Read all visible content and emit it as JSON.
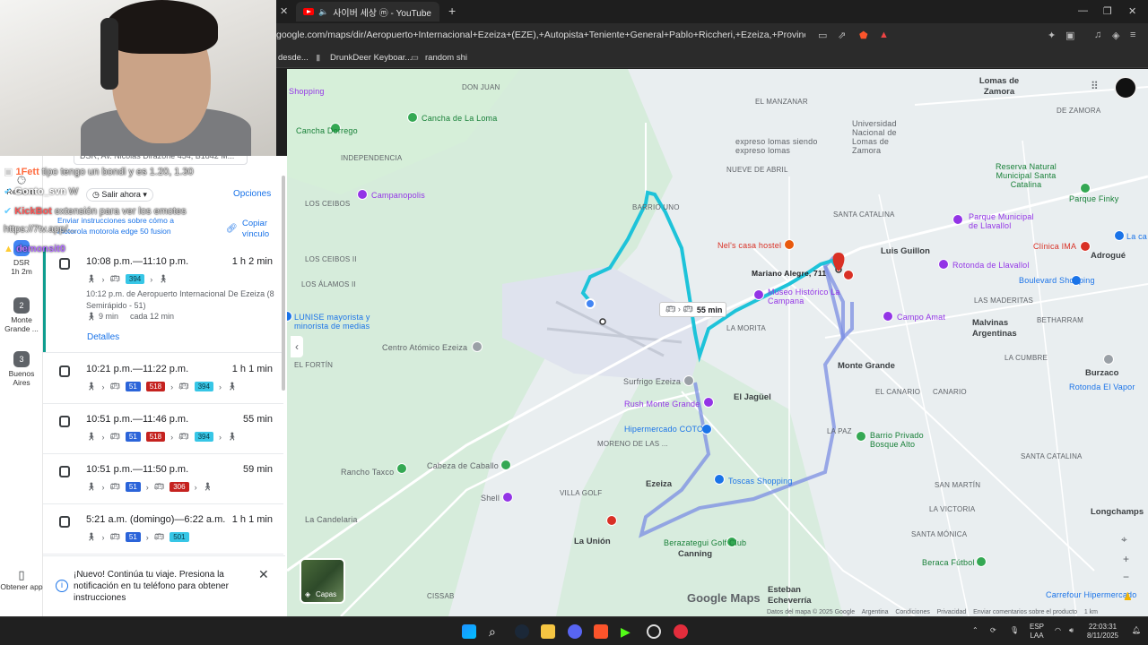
{
  "browser": {
    "tab_title": "사이버 세상 ⓜ - YouTube",
    "url": "google.com/maps/dir/Aeropuerto+Internacional+Ezeiza+(EZE),+Autopista+Teniente+General+Pablo+Riccheri,+Ezeiza,+Provincia+de+Buenos...",
    "bookmarks": [
      "desde...",
      "DrunkDeer Keyboar...",
      "random shi"
    ]
  },
  "left_nav": [
    {
      "label": "Reciente"
    },
    {
      "label": "DSR",
      "sub": "1h 2m"
    },
    {
      "label": "Monte Grande ...",
      "num": "2"
    },
    {
      "label": "Buenos Aires",
      "num": "3"
    },
    {
      "label": "Obtener app"
    }
  ],
  "panel": {
    "origin_field": "DSR, Av. Nicolás Dirazone 454, B1842 M...",
    "depart_label": "Salir ahora",
    "options_label": "Opciones",
    "send_text": "Enviar instrucciones sobre cómo a motorola motorola edge 50 fusion",
    "copy_link": "Copiar vínculo",
    "details_label": "Detalles",
    "selected_route_extra": "10:12 p.m. de Aeropuerto Internacional De Ezeiza (8 Semirápido - 51)",
    "selected_walk": "9 min",
    "selected_freq": "cada 12 min",
    "routes": [
      {
        "time": "10:08 p.m.—11:10 p.m.",
        "duration": "1 h 2 min",
        "badges": [
          {
            "text": "394",
            "color": "cyan"
          }
        ]
      },
      {
        "time": "10:21 p.m.—11:22 p.m.",
        "duration": "1 h 1 min",
        "badges": [
          {
            "text": "51",
            "color": "blue"
          },
          {
            "text": "518",
            "color": "red"
          },
          {
            "text": "394",
            "color": "cyan"
          }
        ]
      },
      {
        "time": "10:51 p.m.—11:46 p.m.",
        "duration": "55 min",
        "badges": [
          {
            "text": "51",
            "color": "blue"
          },
          {
            "text": "518",
            "color": "red"
          },
          {
            "text": "394",
            "color": "cyan"
          }
        ]
      },
      {
        "time": "10:51 p.m.—11:50 p.m.",
        "duration": "59 min",
        "badges": [
          {
            "text": "51",
            "color": "blue"
          },
          {
            "text": "306",
            "color": "red"
          }
        ]
      },
      {
        "time": "5:21 a.m. (domingo)—6:22 a.m.",
        "duration": "1 h 1 min",
        "badges": [
          {
            "text": "51",
            "color": "blue"
          },
          {
            "text": "501",
            "color": "cyan"
          }
        ]
      }
    ],
    "notification": "¡Nuevo! Continúa tu viaje. Presiona la notificación en tu teléfono para obtener instrucciones"
  },
  "chat": [
    {
      "user": "1Fett",
      "text": "tipo tengo un bondi y es 1.20, 1.30",
      "color": "#ff6a3d"
    },
    {
      "user": "Gonto_svn",
      "text": "W",
      "color": "#ffffff"
    },
    {
      "user": "KickBot",
      "text": "extensión para ver los emotes",
      "color": "#ff5a5a"
    },
    {
      "user": "",
      "text": "https://7tv.app/...",
      "color": "#ffffff"
    },
    {
      "user": "demonsit0",
      "text": "",
      "color": "#b06cff"
    }
  ],
  "map": {
    "duration_box": "55 min",
    "destination": "Mariano Alegre, 711",
    "layers_label": "Capas",
    "brand": "Google Maps",
    "copyright": [
      "Datos del mapa © 2025 Google",
      "Argentina",
      "Condiciones",
      "Privacidad",
      "Enviar comentarios sobre el producto",
      "1 km"
    ],
    "labels": [
      {
        "t": "DON JUAN"
      },
      {
        "t": "INDEPENDENCIA"
      },
      {
        "t": "LOS CEIBOS"
      },
      {
        "t": "BARRIO UNO"
      },
      {
        "t": "NUEVE DE ABRIL"
      },
      {
        "t": "EL MANZANAR"
      },
      {
        "t": "LOS ÁLAMOS II"
      },
      {
        "t": "LOS CEIBOS II"
      },
      {
        "t": "EL FORTÍN"
      },
      {
        "t": "LA MORITA"
      },
      {
        "t": "Monte Grande"
      },
      {
        "t": "El Jagüel"
      },
      {
        "t": "Luis Guillon"
      },
      {
        "t": "SANTA CATALINA"
      },
      {
        "t": "Malvinas Argentinas"
      },
      {
        "t": "Ezeiza"
      },
      {
        "t": "MORENO DE LAS ...",
        "id": "moreno"
      },
      {
        "t": "VILLA GOLF"
      },
      {
        "t": "La Unión"
      },
      {
        "t": "Canning"
      },
      {
        "t": "Esteban Echeverría"
      },
      {
        "t": "EL CANARIO"
      },
      {
        "t": "LA PAZ"
      },
      {
        "t": "SANTA CATALINA",
        "id": "sc2"
      },
      {
        "t": "SAN MARTÍN"
      },
      {
        "t": "LA VICTORIA"
      },
      {
        "t": "SANTA MÓNICA"
      },
      {
        "t": "LAS MADERITAS"
      },
      {
        "t": "BETHARRAM"
      },
      {
        "t": "Burzaco"
      },
      {
        "t": "Adrogué"
      },
      {
        "t": "Longchamps"
      },
      {
        "t": "Lomas de Zamora"
      },
      {
        "t": "DE ZAMORA"
      },
      {
        "t": "CISSAB"
      },
      {
        "t": "CANARIO"
      },
      {
        "t": "LA CUMBRE"
      }
    ],
    "pois": [
      {
        "t": "Cancha de La Loma",
        "kind": "green"
      },
      {
        "t": "Campanopolis",
        "kind": "purple"
      },
      {
        "t": "Nel's casa hostel",
        "kind": "pink"
      },
      {
        "t": "Museo Histórico La Campana",
        "kind": "purple"
      },
      {
        "t": "Campo Amat",
        "kind": "purple"
      },
      {
        "t": "Centro Atómico Ezeiza",
        "kind": "gray"
      },
      {
        "t": "Surfrigo Ezeiza",
        "kind": "gray"
      },
      {
        "t": "Rush Monte Grande",
        "kind": "purple"
      },
      {
        "t": "Hipermercado COTO",
        "kind": "blue"
      },
      {
        "t": "Toscas Shopping",
        "kind": "blue"
      },
      {
        "t": "Rancho Taxco",
        "kind": "gray"
      },
      {
        "t": "Cabeza de Caballo",
        "kind": "gray"
      },
      {
        "t": "Shell",
        "kind": "gray"
      },
      {
        "t": "Barrio Privado Bosque Alto",
        "kind": "green"
      },
      {
        "t": "Rotonda de Llavallol",
        "kind": "purple"
      },
      {
        "t": "Parque Municipal de Llavallol",
        "kind": "purple"
      },
      {
        "t": "Clínica IMA",
        "kind": "pink"
      },
      {
        "t": "Boulevard Shopping",
        "kind": "blue"
      },
      {
        "t": "Rotonda El Vapor",
        "kind": "blue"
      },
      {
        "t": "Berazategui Golf Club",
        "kind": "green"
      },
      {
        "t": "Beraca Fútbol",
        "kind": "green"
      },
      {
        "t": "Carrefour Hipermercado",
        "kind": "blue"
      },
      {
        "t": "Universidad Nacional de Lomas de Zamora",
        "kind": "gray"
      },
      {
        "t": "Reserva Natural Municipal Santa Catalina",
        "kind": "green"
      },
      {
        "t": "Parque Finky",
        "kind": "green"
      },
      {
        "t": "expreso lomas siendo expreso lomas",
        "kind": "gray"
      },
      {
        "t": "LUNISE mayorista y minorista de medias",
        "kind": "blue"
      },
      {
        "t": "Shopping",
        "id": "shopping_top",
        "kind": "purple"
      },
      {
        "t": "Cancha Dorrego",
        "kind": "green"
      },
      {
        "t": "La Candelaria",
        "kind": "gray"
      },
      {
        "t": "La ca",
        "kind": "blue"
      }
    ]
  },
  "taskbar": {
    "lang": "ESP",
    "lang2": "LAA",
    "time": "22:03:31",
    "date": "8/11/2025"
  }
}
